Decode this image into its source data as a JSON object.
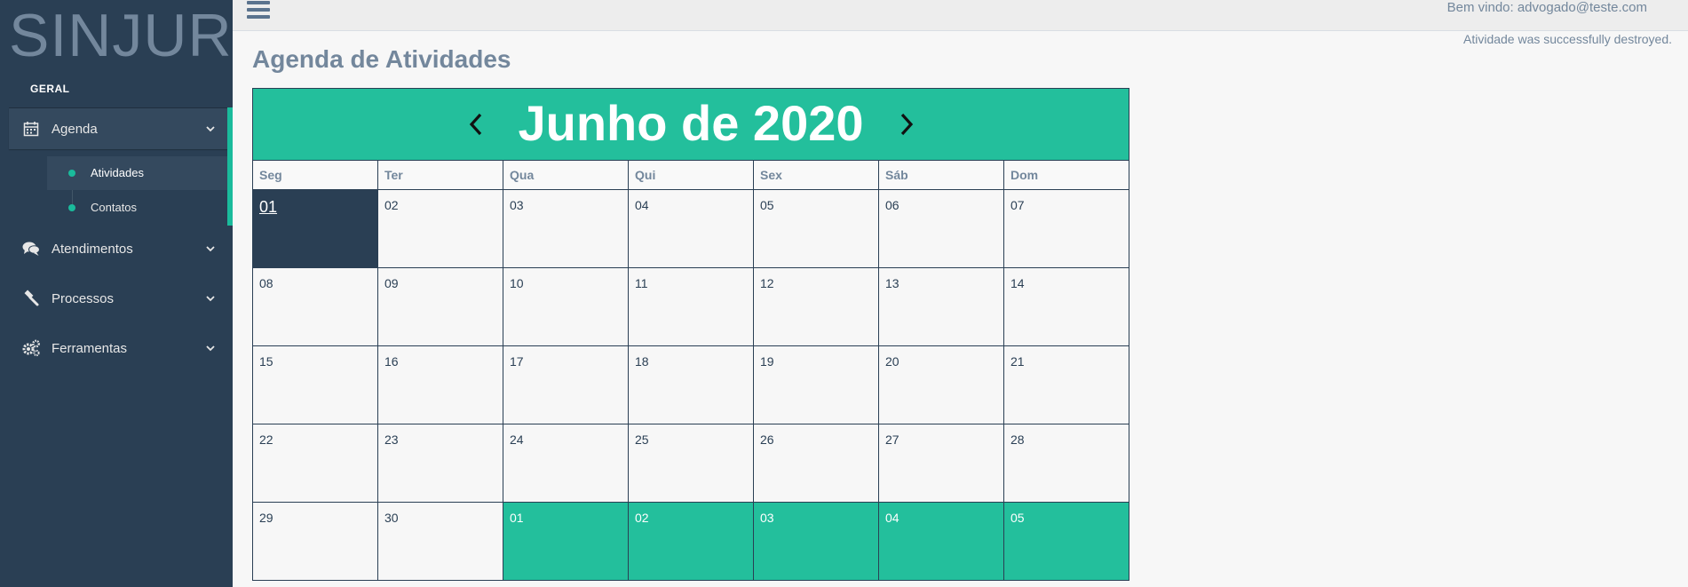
{
  "brand": "SINJUR",
  "sidebar": {
    "section_title": "GERAL",
    "items": [
      {
        "label": "Agenda",
        "icon": "calendar-icon"
      },
      {
        "label": "Atendimentos",
        "icon": "comments-icon"
      },
      {
        "label": "Processos",
        "icon": "gavel-icon"
      },
      {
        "label": "Ferramentas",
        "icon": "gears-icon"
      }
    ],
    "submenu": [
      {
        "label": "Atividades"
      },
      {
        "label": "Contatos"
      }
    ]
  },
  "topnav": {
    "welcome": "Bem vindo: advogado@teste.com",
    "flash": "Atividade was successfully destroyed."
  },
  "page": {
    "title": "Agenda de Atividades"
  },
  "calendar": {
    "title": "Junho de 2020",
    "weekdays": [
      "Seg",
      "Ter",
      "Qua",
      "Qui",
      "Sex",
      "Sáb",
      "Dom"
    ],
    "weeks": [
      [
        "01",
        "02",
        "03",
        "04",
        "05",
        "06",
        "07"
      ],
      [
        "08",
        "09",
        "10",
        "11",
        "12",
        "13",
        "14"
      ],
      [
        "15",
        "16",
        "17",
        "18",
        "19",
        "20",
        "21"
      ],
      [
        "22",
        "23",
        "24",
        "25",
        "26",
        "27",
        "28"
      ],
      [
        "29",
        "30",
        "01",
        "02",
        "03",
        "04",
        "05"
      ]
    ]
  },
  "colors": {
    "sidebar_bg": "#2a3f54",
    "accent": "#1abb9c",
    "calendar_header": "#23bf9c"
  }
}
